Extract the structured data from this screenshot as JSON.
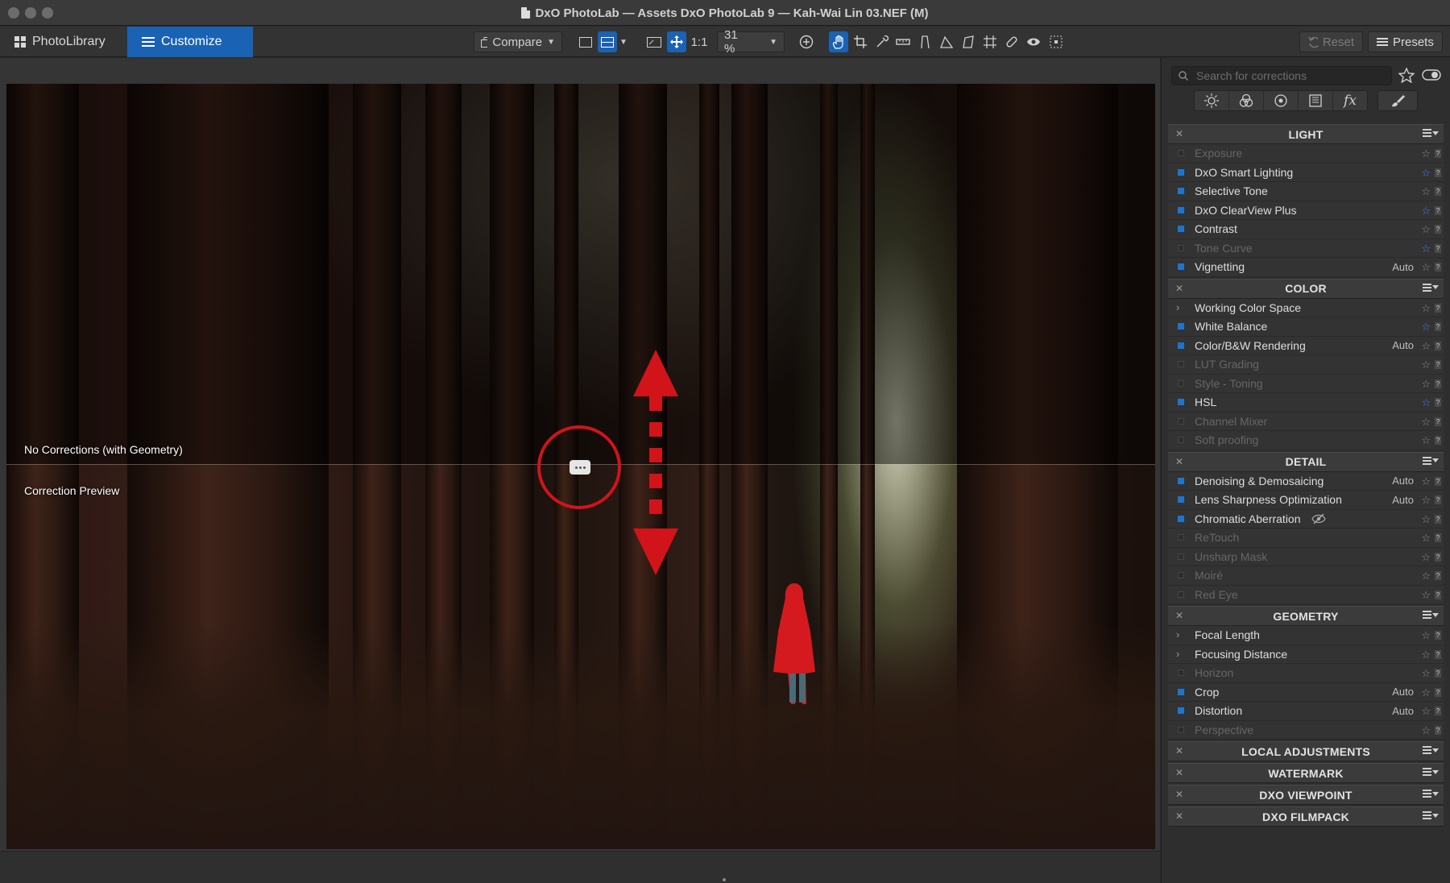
{
  "window": {
    "title": "DxO PhotoLab — Assets DxO PhotoLab 9 — Kah-Wai Lin 03.NEF (M)"
  },
  "toolbar": {
    "tab_photolibrary": "PhotoLibrary",
    "tab_customize": "Customize",
    "compare_label": "Compare",
    "one_to_one": "1:1",
    "zoom": "31 %",
    "reset_label": "Reset",
    "presets_label": "Presets"
  },
  "viewer": {
    "top_label": "No Corrections (with Geometry)",
    "bottom_label": "Correction Preview"
  },
  "panel": {
    "search_placeholder": "Search for corrections",
    "palette_icons": [
      "light-icon",
      "color-icon",
      "detail-icon",
      "geometry-icon",
      "fx-icon"
    ],
    "sections": [
      {
        "title": "LIGHT",
        "items": [
          {
            "label": "Exposure",
            "active": false,
            "auto": "",
            "fav": false
          },
          {
            "label": "DxO Smart Lighting",
            "active": true,
            "auto": "",
            "fav": true
          },
          {
            "label": "Selective Tone",
            "active": true,
            "auto": "",
            "fav": false
          },
          {
            "label": "DxO ClearView Plus",
            "active": true,
            "auto": "",
            "fav": true
          },
          {
            "label": "Contrast",
            "active": true,
            "auto": "",
            "fav": false
          },
          {
            "label": "Tone Curve",
            "active": false,
            "auto": "",
            "fav": true
          },
          {
            "label": "Vignetting",
            "active": true,
            "auto": "Auto",
            "fav": false
          }
        ]
      },
      {
        "title": "COLOR",
        "items": [
          {
            "label": "Working Color Space",
            "active": true,
            "expand": true,
            "auto": "",
            "fav": false
          },
          {
            "label": "White Balance",
            "active": true,
            "auto": "",
            "fav": true
          },
          {
            "label": "Color/B&W Rendering",
            "active": true,
            "auto": "Auto",
            "fav": false
          },
          {
            "label": "LUT Grading",
            "active": false,
            "auto": "",
            "fav": false
          },
          {
            "label": "Style - Toning",
            "active": false,
            "auto": "",
            "fav": false
          },
          {
            "label": "HSL",
            "active": true,
            "auto": "",
            "fav": true
          },
          {
            "label": "Channel Mixer",
            "active": false,
            "auto": "",
            "fav": false
          },
          {
            "label": "Soft proofing",
            "active": false,
            "auto": "",
            "fav": false
          }
        ]
      },
      {
        "title": "DETAIL",
        "items": [
          {
            "label": "Denoising & Demosaicing",
            "active": true,
            "auto": "Auto",
            "fav": false
          },
          {
            "label": "Lens Sharpness Optimization",
            "active": true,
            "auto": "Auto",
            "fav": false
          },
          {
            "label": "Chromatic Aberration",
            "active": true,
            "auto": "",
            "fav": false,
            "hidden_icon": true
          },
          {
            "label": "ReTouch",
            "active": false,
            "auto": "",
            "fav": false
          },
          {
            "label": "Unsharp Mask",
            "active": false,
            "auto": "",
            "fav": false
          },
          {
            "label": "Moiré",
            "active": false,
            "auto": "",
            "fav": false
          },
          {
            "label": "Red Eye",
            "active": false,
            "auto": "",
            "fav": false
          }
        ]
      },
      {
        "title": "GEOMETRY",
        "items": [
          {
            "label": "Focal Length",
            "active": true,
            "expand": true,
            "auto": "",
            "fav": false
          },
          {
            "label": "Focusing Distance",
            "active": true,
            "expand": true,
            "auto": "",
            "fav": false
          },
          {
            "label": "Horizon",
            "active": false,
            "auto": "",
            "fav": false
          },
          {
            "label": "Crop",
            "active": true,
            "auto": "Auto",
            "fav": false
          },
          {
            "label": "Distortion",
            "active": true,
            "auto": "Auto",
            "fav": false
          },
          {
            "label": "Perspective",
            "active": false,
            "auto": "",
            "fav": false
          }
        ]
      },
      {
        "title": "LOCAL ADJUSTMENTS",
        "items": []
      },
      {
        "title": "WATERMARK",
        "items": []
      },
      {
        "title": "DXO VIEWPOINT",
        "items": []
      },
      {
        "title": "DXO FILMPACK",
        "items": []
      }
    ]
  },
  "colors": {
    "accent": "#1a62b4",
    "checkbox_on": "#1d75d0",
    "favorite_star": "#2f8ef2",
    "annotation_red": "#d0141a"
  }
}
